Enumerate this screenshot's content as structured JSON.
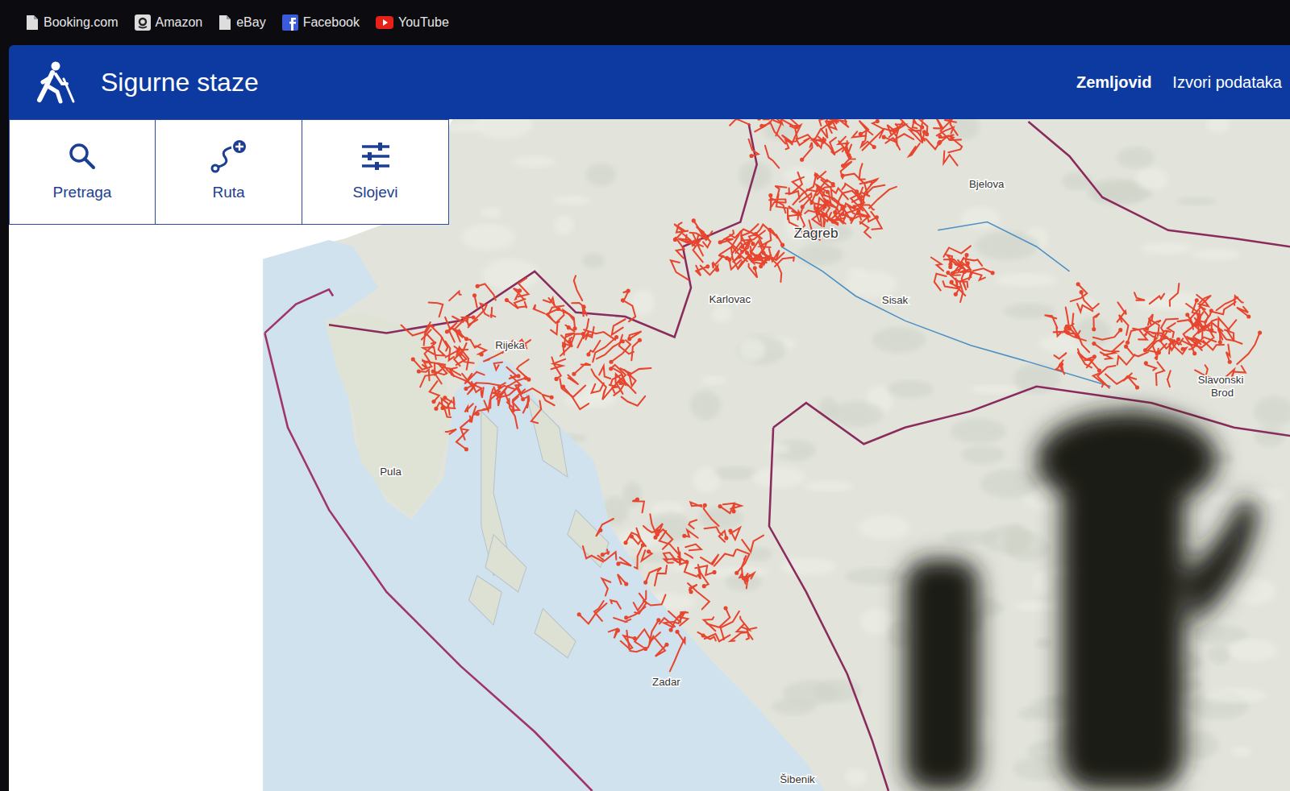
{
  "browser": {
    "bookmarks": [
      {
        "label": "Booking.com"
      },
      {
        "label": "Amazon"
      },
      {
        "label": "eBay"
      },
      {
        "label": "Facebook"
      },
      {
        "label": "YouTube"
      }
    ]
  },
  "header": {
    "title": "Sigurne staze",
    "nav": [
      {
        "label": "Zemljovid",
        "selected": true
      },
      {
        "label": "Izvori podataka",
        "selected": false
      }
    ]
  },
  "tools": [
    {
      "label": "Pretraga"
    },
    {
      "label": "Ruta"
    },
    {
      "label": "Slojevi"
    }
  ],
  "map": {
    "places": [
      {
        "label": "Bjelova"
      },
      {
        "label": "Zagreb"
      },
      {
        "label": "Karlovac"
      },
      {
        "label": "Sisak"
      },
      {
        "label": "Rijeka"
      },
      {
        "label": "Pula"
      },
      {
        "label": "Slavonski"
      },
      {
        "label": "Brod"
      },
      {
        "label": "Zadar"
      },
      {
        "label": "Šibenik"
      }
    ]
  }
}
